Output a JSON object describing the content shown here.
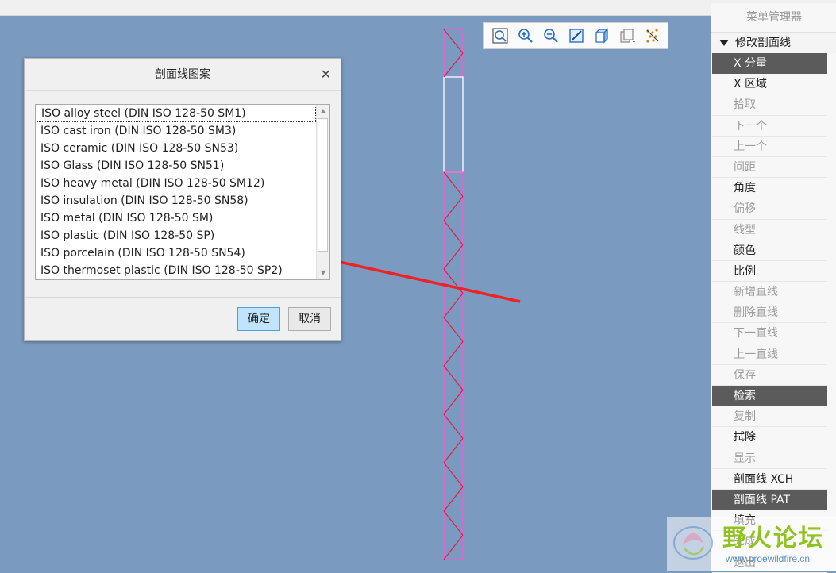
{
  "toolbar": {
    "icons": [
      "zoom-fit-icon",
      "zoom-in-icon",
      "zoom-out-icon",
      "repaint-icon",
      "view-orientation-icon",
      "saved-views-icon",
      "display-style-icon"
    ]
  },
  "dialog": {
    "title": "剖面线图案",
    "close_symbol": "✕",
    "items": [
      "ISO alloy steel (DIN ISO 128-50 SM1)",
      "ISO cast iron (DIN ISO 128-50 SM3)",
      "ISO ceramic (DIN ISO 128-50 SN53)",
      "ISO Glass (DIN ISO 128-50 SN51)",
      "ISO heavy metal (DIN ISO 128-50 SM12)",
      "ISO insulation (DIN ISO 128-50 SN58)",
      "ISO metal (DIN ISO 128-50 SM)",
      "ISO plastic (DIN ISO 128-50 SP)",
      "ISO porcelain (DIN ISO 128-50 SN54)",
      "ISO thermoset plastic (DIN ISO 128-50 SP2)"
    ],
    "selected_index": 0,
    "ok_label": "确定",
    "cancel_label": "取消"
  },
  "menu": {
    "header": "菜单管理器",
    "section": "修改剖面线",
    "items": [
      {
        "label": "X 分量",
        "state": "active"
      },
      {
        "label": "X 区域",
        "state": "normal"
      },
      {
        "label": "拾取",
        "state": "disabled"
      },
      {
        "label": "下一个",
        "state": "disabled"
      },
      {
        "label": "上一个",
        "state": "disabled"
      },
      {
        "label": "间距",
        "state": "disabled"
      },
      {
        "label": "角度",
        "state": "normal"
      },
      {
        "label": "偏移",
        "state": "disabled"
      },
      {
        "label": "线型",
        "state": "disabled"
      },
      {
        "label": "颜色",
        "state": "normal"
      },
      {
        "label": "比例",
        "state": "normal"
      },
      {
        "label": "新增直线",
        "state": "disabled"
      },
      {
        "label": "删除直线",
        "state": "disabled"
      },
      {
        "label": "下一直线",
        "state": "disabled"
      },
      {
        "label": "上一直线",
        "state": "disabled"
      },
      {
        "label": "保存",
        "state": "disabled"
      },
      {
        "label": "检索",
        "state": "active"
      },
      {
        "label": "复制",
        "state": "disabled"
      },
      {
        "label": "拭除",
        "state": "normal"
      },
      {
        "label": "显示",
        "state": "disabled"
      },
      {
        "label": "剖面线 XCH",
        "state": "normal"
      },
      {
        "label": "剖面线 PAT",
        "state": "active"
      },
      {
        "label": "填充",
        "state": "normal"
      },
      {
        "label": "完成",
        "state": "normal"
      },
      {
        "label": "退出",
        "state": "normal"
      }
    ]
  },
  "watermark": {
    "title": "野火论坛",
    "url": "www.proewildfire.cn"
  },
  "colors": {
    "canvas": "#7b9ac0",
    "hatch_line": "#e8194f",
    "part_outline": "#ff55d8",
    "arrow": "#ee2222"
  }
}
